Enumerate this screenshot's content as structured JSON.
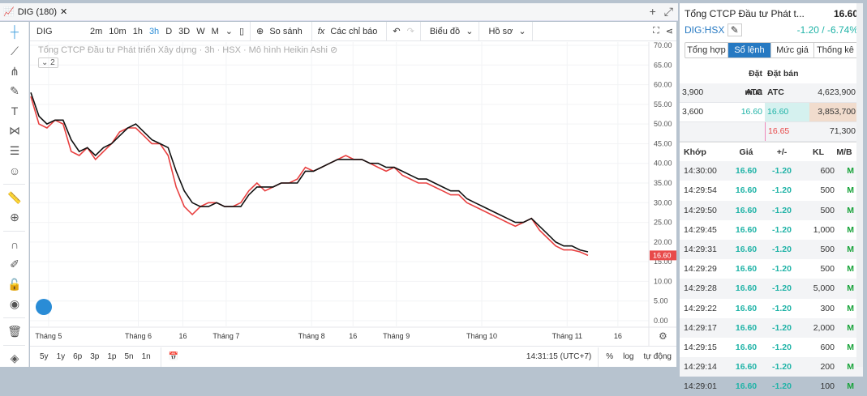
{
  "tab": {
    "title": "DIG (180)",
    "close": "✕",
    "plus": "+",
    "expand": "⤢"
  },
  "toolbar": {
    "symbol": "DIG",
    "intervals": [
      "2m",
      "10m",
      "1h",
      "3h",
      "D",
      "3D",
      "W",
      "M"
    ],
    "active_interval": "3h",
    "compare": "So sánh",
    "indicators": "Các chỉ báo",
    "chart_type": "Biểu đồ",
    "profile": "Hồ sơ"
  },
  "legend": {
    "title": "Tổng CTCP Đầu tư Phát triển Xây dựng · 3h · HSX · Mô hình Heikin Ashi",
    "collapse": "2"
  },
  "bottom": {
    "ranges": [
      "5y",
      "1y",
      "6p",
      "3p",
      "1p",
      "5n",
      "1n"
    ],
    "time": "14:31:15 (UTC+7)",
    "percent": "%",
    "log": "log",
    "auto": "tự động"
  },
  "chart_data": {
    "type": "line",
    "title": "Tổng CTCP Đầu tư Phát triển Xây dựng · 3h · HSX · Mô hình Heikin Ashi",
    "ylim": [
      0,
      70
    ],
    "yticks": [
      "70.00",
      "65.00",
      "60.00",
      "55.00",
      "50.00",
      "45.00",
      "40.00",
      "35.00",
      "30.00",
      "25.00",
      "20.00",
      "15.00",
      "10.00",
      "5.00",
      "0.00"
    ],
    "xticks": [
      {
        "label": "Tháng 5",
        "pos": 0.03
      },
      {
        "label": "Tháng 6",
        "pos": 0.175
      },
      {
        "label": "16",
        "pos": 0.247
      },
      {
        "label": "Tháng 7",
        "pos": 0.317
      },
      {
        "label": "Tháng 8",
        "pos": 0.455
      },
      {
        "label": "16",
        "pos": 0.522
      },
      {
        "label": "Tháng 9",
        "pos": 0.592
      },
      {
        "label": "Tháng 10",
        "pos": 0.73
      },
      {
        "label": "Tháng 11",
        "pos": 0.868
      },
      {
        "label": "16",
        "pos": 0.95
      }
    ],
    "last_price": "16.60",
    "last_color": "#e84a4a",
    "series": [
      {
        "name": "black",
        "color": "#111111",
        "values": [
          58,
          52,
          50,
          51,
          51,
          46,
          43,
          44,
          42,
          44,
          45,
          47,
          49,
          50,
          48,
          46,
          45,
          44,
          38,
          33,
          30,
          29,
          29,
          30,
          29,
          29,
          29,
          32,
          34,
          34,
          34,
          35,
          35,
          35,
          38,
          38,
          39,
          40,
          41,
          41,
          41,
          41,
          40,
          40,
          39,
          39,
          38,
          37,
          36,
          36,
          35,
          34,
          33,
          33,
          31,
          30,
          29,
          28,
          27,
          26,
          25,
          25,
          26,
          24,
          22,
          20,
          19,
          19,
          18,
          17.5
        ]
      },
      {
        "name": "red",
        "color": "#e84040",
        "values": [
          57,
          50,
          49,
          51,
          50,
          43,
          42,
          44,
          41,
          43,
          45,
          48,
          49,
          49,
          47,
          45,
          45,
          42,
          34,
          29,
          27,
          29,
          30,
          30,
          29,
          29,
          30,
          33,
          35,
          33,
          34,
          35,
          35,
          36,
          39,
          38,
          39,
          40,
          41,
          42,
          41,
          41,
          40,
          39,
          38,
          39,
          37,
          36,
          35,
          35,
          34,
          33,
          32,
          32,
          30,
          29,
          28,
          27,
          26,
          25,
          24,
          25,
          26,
          23,
          21,
          19,
          18,
          18,
          17.5,
          16.6
        ]
      }
    ]
  },
  "quote": {
    "name": "Tổng CTCP Đầu tư Phát t...",
    "price": "16.60",
    "symbol": "DIG:HSX",
    "change": "-1.20 / -6.74%",
    "tabs": [
      "Tổng hợp",
      "Sổ lệnh",
      "Mức giá",
      "Thống kê"
    ],
    "active_tab": "Sổ lệnh"
  },
  "orderbook": {
    "headers": [
      "",
      "Đặt mua",
      "Đặt bán",
      ""
    ],
    "rows": [
      [
        "3,900",
        "ATC",
        "ATC",
        "4,623,900"
      ],
      [
        "3,600",
        "16.60",
        "16.60",
        "3,853,700"
      ],
      [
        "",
        "",
        "16.65",
        "71,300"
      ]
    ]
  },
  "trades": {
    "headers": [
      "Khớp",
      "Giá",
      "+/-",
      "KL",
      "M/B"
    ],
    "rows": [
      [
        "14:30:00",
        "16.60",
        "-1.20",
        "600",
        "M"
      ],
      [
        "14:29:54",
        "16.60",
        "-1.20",
        "500",
        "M"
      ],
      [
        "14:29:50",
        "16.60",
        "-1.20",
        "500",
        "M"
      ],
      [
        "14:29:45",
        "16.60",
        "-1.20",
        "1,000",
        "M"
      ],
      [
        "14:29:31",
        "16.60",
        "-1.20",
        "500",
        "M"
      ],
      [
        "14:29:29",
        "16.60",
        "-1.20",
        "500",
        "M"
      ],
      [
        "14:29:28",
        "16.60",
        "-1.20",
        "5,000",
        "M"
      ],
      [
        "14:29:22",
        "16.60",
        "-1.20",
        "300",
        "M"
      ],
      [
        "14:29:17",
        "16.60",
        "-1.20",
        "2,000",
        "M"
      ],
      [
        "14:29:15",
        "16.60",
        "-1.20",
        "600",
        "M"
      ],
      [
        "14:29:14",
        "16.60",
        "-1.20",
        "200",
        "M"
      ],
      [
        "14:29:01",
        "16.60",
        "-1.20",
        "100",
        "M"
      ]
    ]
  }
}
